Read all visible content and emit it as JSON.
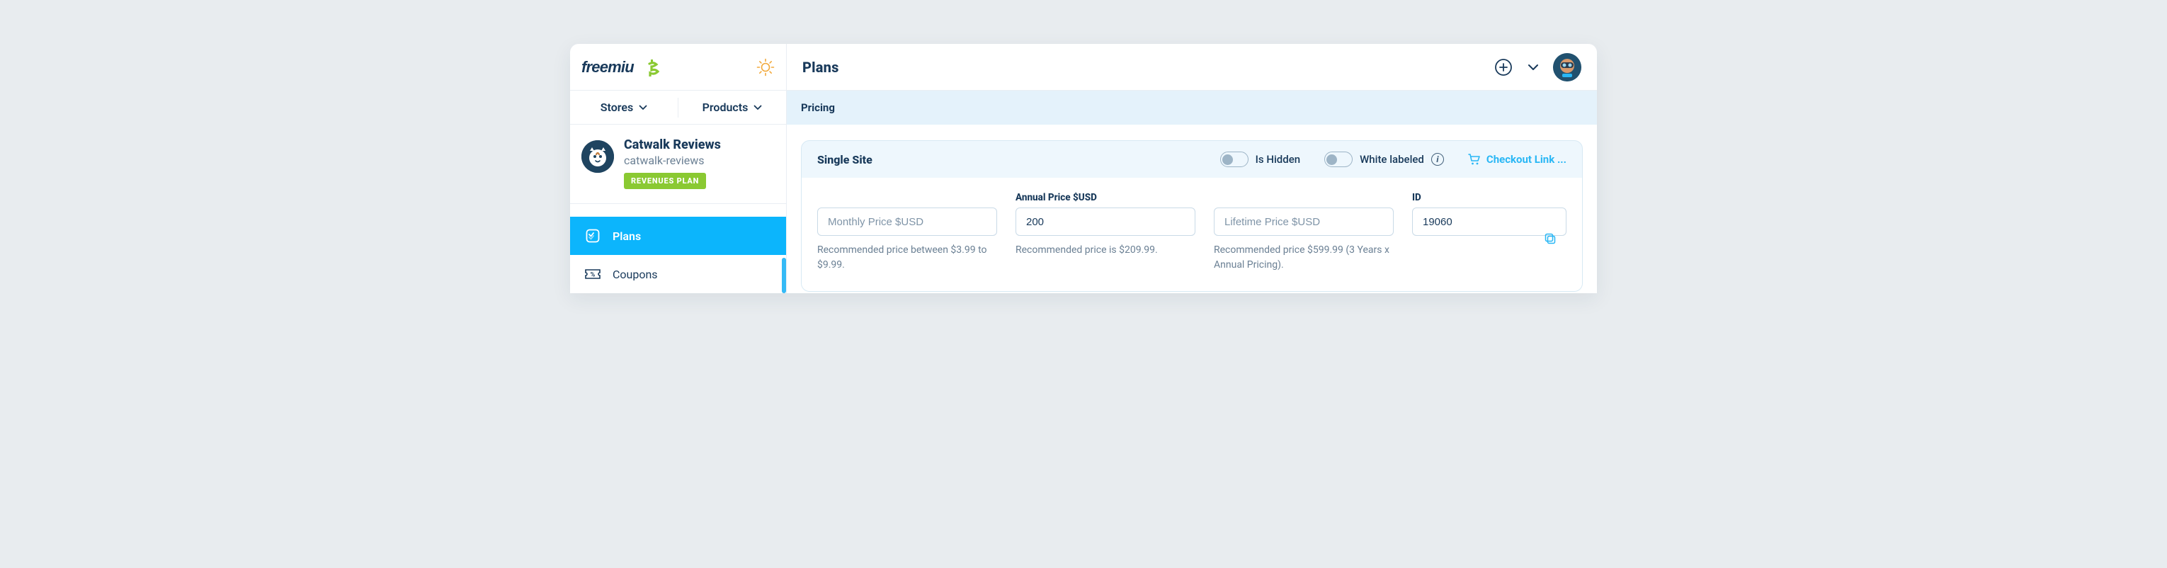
{
  "header": {
    "logo_text": "freemius",
    "page_title": "Plans"
  },
  "sidebar": {
    "dropdowns": {
      "stores": "Stores",
      "products": "Products"
    },
    "product": {
      "name": "Catwalk Reviews",
      "slug": "catwalk-reviews",
      "badge": "REVENUES PLAN"
    },
    "nav": {
      "plans": "Plans",
      "coupons": "Coupons"
    }
  },
  "content": {
    "active_tab": "Pricing",
    "panel_title": "Single Site",
    "toggles": {
      "is_hidden": "Is Hidden",
      "white_labeled": "White labeled"
    },
    "checkout_link": "Checkout Link ...",
    "fields": {
      "monthly": {
        "placeholder": "Monthly Price $USD",
        "helper": "Recommended price between $3.99 to $9.99."
      },
      "annual": {
        "label": "Annual Price $USD",
        "value": "200",
        "helper": "Recommended price is $209.99."
      },
      "lifetime": {
        "placeholder": "Lifetime Price $USD",
        "helper": "Recommended price $599.99 (3 Years x Annual Pricing)."
      },
      "id": {
        "label": "ID",
        "value": "19060"
      }
    }
  }
}
